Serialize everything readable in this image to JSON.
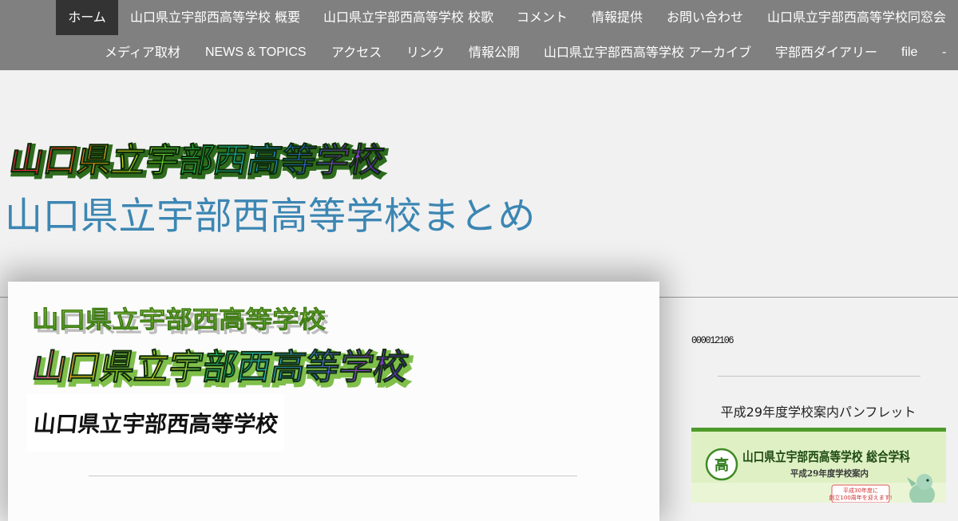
{
  "nav": {
    "row1": [
      {
        "label": "ホーム",
        "active": true
      },
      {
        "label": "山口県立宇部西高等学校 概要"
      },
      {
        "label": "山口県立宇部西高等学校 校歌"
      },
      {
        "label": "コメント"
      },
      {
        "label": "情報提供"
      },
      {
        "label": "お問い合わせ"
      },
      {
        "label": "山口県立宇部西高等学校同窓会"
      }
    ],
    "row2": [
      {
        "label": "メディア取材"
      },
      {
        "label": "NEWS & TOPICS"
      },
      {
        "label": "アクセス"
      },
      {
        "label": "リンク"
      },
      {
        "label": "情報公開"
      },
      {
        "label": "山口県立宇部西高等学校 アーカイブ"
      },
      {
        "label": "宇部西ダイアリー"
      },
      {
        "label": "file"
      },
      {
        "label": "-"
      }
    ]
  },
  "header": {
    "logo_text": "山口県立宇部西高等学校",
    "site_title": "山口県立宇部西高等学校まとめ"
  },
  "main": {
    "wordart_top": "山口県立宇部西高等学校",
    "wordart_rainbow": "山口県立宇部西高等学校",
    "calligraphy": "山口県立宇部西高等学校"
  },
  "sidebar": {
    "counter": "000012106",
    "pamphlet_heading": "平成29年度学校案内パンフレット",
    "pamphlet": {
      "school_name": "山口県立宇部西高等学校 総合学科",
      "subtitle": "平成29年度学校案内",
      "emblem_char": "高",
      "note_line1": "平成30年度に",
      "note_line2": "創立100周年を迎えます!"
    }
  },
  "colors": {
    "nav_bg": "#808080",
    "nav_active_bg": "#333333",
    "page_bg": "#f1f1f1",
    "title_blue": "#3c86b3",
    "pamphlet_green": "#5a9a3a"
  }
}
